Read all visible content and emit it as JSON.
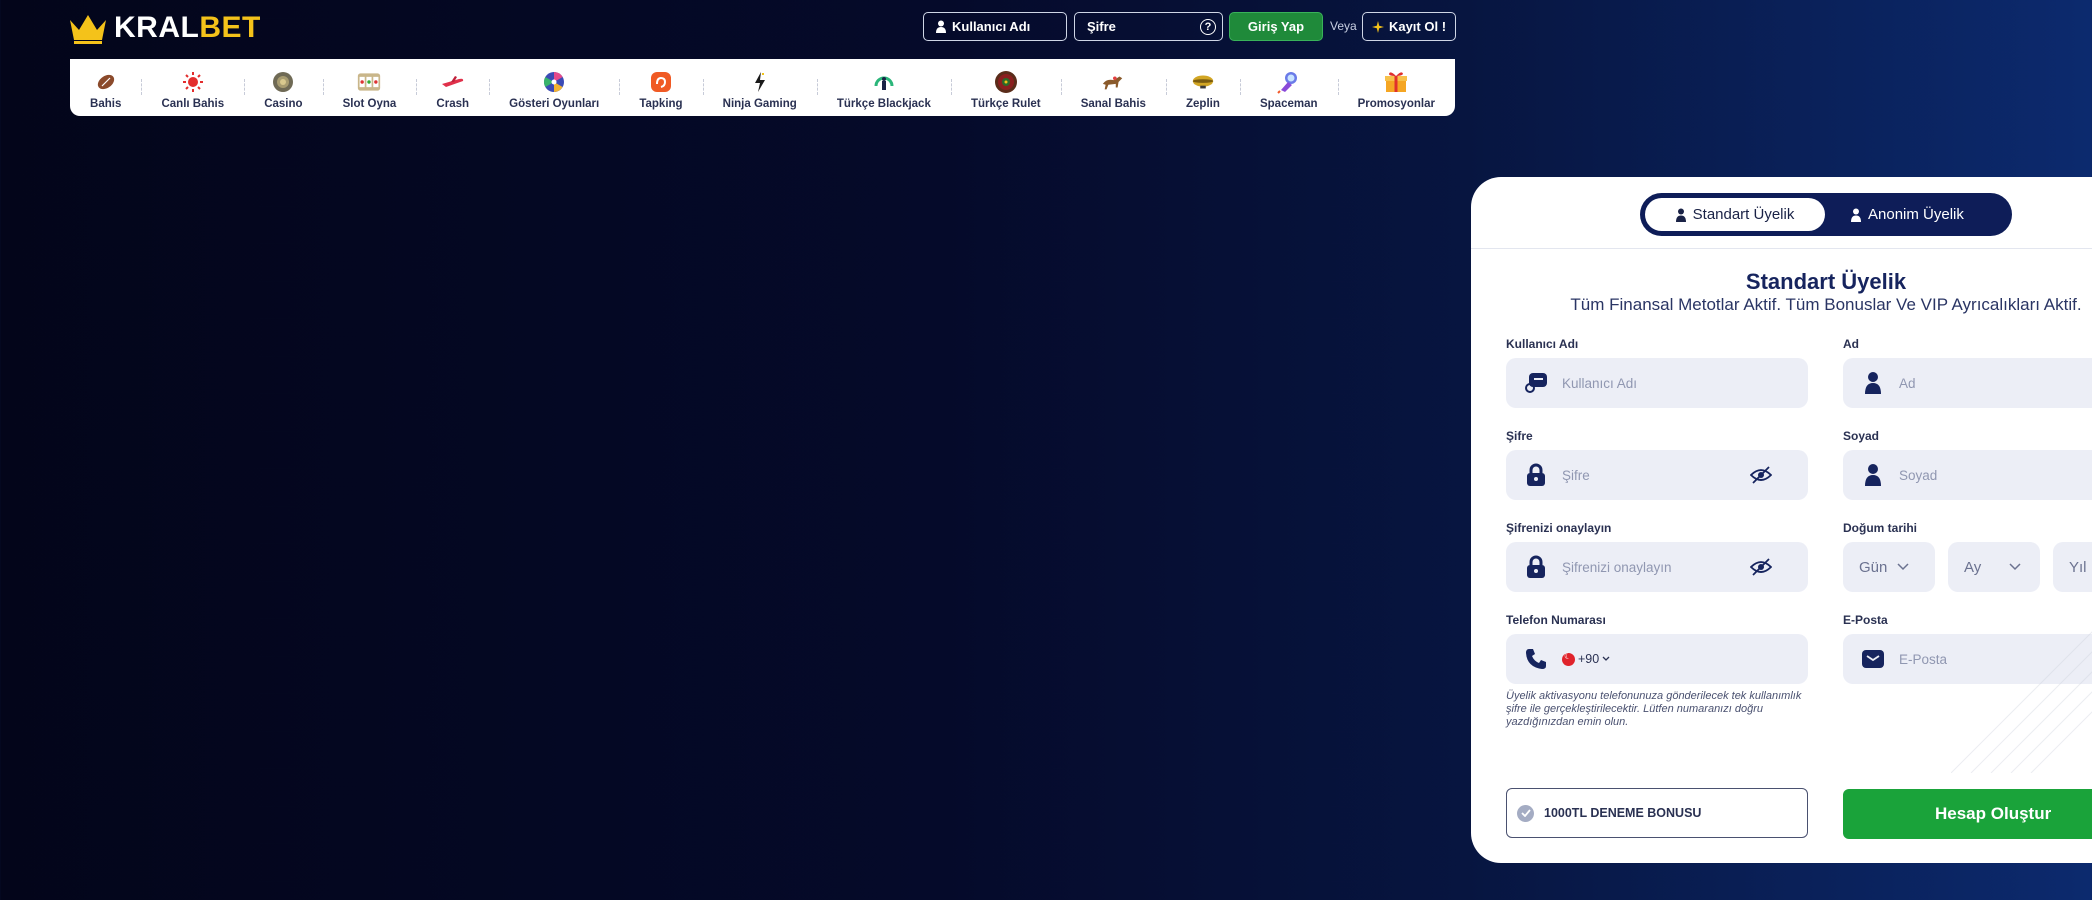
{
  "header": {
    "logo_part1": "KRAL",
    "logo_part2": "BET",
    "username_label": "Kullanıcı Adı",
    "password_label": "Şifre",
    "help_label": "?",
    "login_button": "Giriş Yap",
    "or_text": "Veya",
    "register_button": "Kayıt Ol !"
  },
  "nav": {
    "items": [
      {
        "label": "Bahis",
        "icon": "football-icon"
      },
      {
        "label": "Canlı Bahis",
        "icon": "live-icon"
      },
      {
        "label": "Casino",
        "icon": "casino-chip-icon"
      },
      {
        "label": "Slot Oyna",
        "icon": "slot-icon"
      },
      {
        "label": "Crash",
        "icon": "plane-icon"
      },
      {
        "label": "Gösteri Oyunları",
        "icon": "wheel-icon"
      },
      {
        "label": "Tapking",
        "icon": "tapking-icon"
      },
      {
        "label": "Ninja Gaming",
        "icon": "ninja-icon"
      },
      {
        "label": "Türkçe Blackjack",
        "icon": "blackjack-icon"
      },
      {
        "label": "Türkçe Rulet",
        "icon": "roulette-icon"
      },
      {
        "label": "Sanal Bahis",
        "icon": "horse-icon"
      },
      {
        "label": "Zeplin",
        "icon": "zeppelin-icon"
      },
      {
        "label": "Spaceman",
        "icon": "spaceman-icon"
      },
      {
        "label": "Promosyonlar",
        "icon": "gift-icon"
      }
    ]
  },
  "register": {
    "tab_standard": "Standart Üyelik",
    "tab_anonymous": "Anonim Üyelik",
    "title": "Standart Üyelik",
    "subtitle": "Tüm Finansal Metotlar Aktif. Tüm Bonuslar Ve VIP Ayrıcalıkları Aktif.",
    "fields": {
      "username_label": "Kullanıcı Adı",
      "username_placeholder": "Kullanıcı Adı",
      "name_label": "Ad",
      "name_placeholder": "Ad",
      "password_label": "Şifre",
      "password_placeholder": "Şifre",
      "surname_label": "Soyad",
      "surname_placeholder": "Soyad",
      "confirm_label": "Şifrenizi onaylayın",
      "confirm_placeholder": "Şifrenizi onaylayın",
      "birth_label": "Doğum tarihi",
      "day": "Gün",
      "month": "Ay",
      "year": "Yıl",
      "phone_label": "Telefon Numarası",
      "phone_code": "+90",
      "email_label": "E-Posta",
      "email_placeholder": "E-Posta"
    },
    "note": "Üyelik aktivasyonu telefonunuza gönderilecek tek kullanımlık şifre ile gerçekleştirilecektir. Lütfen numaranızı doğru yazdığınızdan emin olun.",
    "bonus": "1000TL DENEME BONUSU",
    "create_button": "Hesap Oluştur"
  },
  "colors": {
    "accent_gold": "#f4c21a",
    "login_green": "#1f8a3a",
    "create_green": "#1aa33a",
    "navy": "#0e1d58"
  }
}
